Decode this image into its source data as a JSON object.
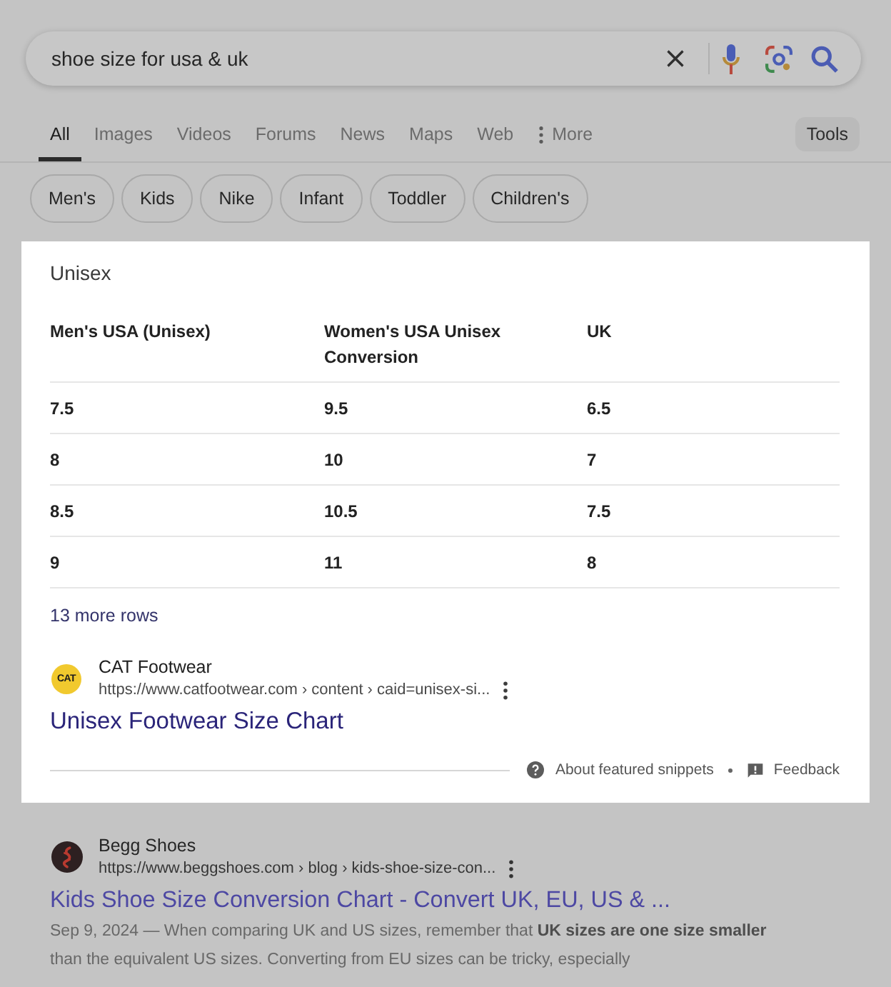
{
  "search": {
    "query": "shoe size for usa & uk"
  },
  "tabs": [
    {
      "label": "All",
      "selected": true,
      "kind": "tab"
    },
    {
      "label": "Images",
      "selected": false,
      "kind": "tab"
    },
    {
      "label": "Videos",
      "selected": false,
      "kind": "tab"
    },
    {
      "label": "Forums",
      "selected": false,
      "kind": "tab"
    },
    {
      "label": "News",
      "selected": false,
      "kind": "tab"
    },
    {
      "label": "Maps",
      "selected": false,
      "kind": "tab"
    },
    {
      "label": "Web",
      "selected": false,
      "kind": "tab"
    },
    {
      "label": "More",
      "selected": false,
      "kind": "menu"
    }
  ],
  "tools_button": "Tools",
  "chips": [
    "Men's",
    "Kids",
    "Nike",
    "Infant",
    "Toddler",
    "Children's"
  ],
  "featured_snippet": {
    "heading": "Unisex",
    "table": {
      "columns": [
        "Men's USA (Unisex)",
        "Women's USA Unisex Conversion",
        "UK"
      ],
      "rows": [
        [
          "7.5",
          "9.5",
          "6.5"
        ],
        [
          "8",
          "10",
          "7"
        ],
        [
          "8.5",
          "10.5",
          "7.5"
        ],
        [
          "9",
          "11",
          "8"
        ]
      ]
    },
    "more_rows": "13 more rows",
    "source": {
      "name": "CAT Footwear",
      "logo_text": "CAT",
      "url": "https://www.catfootwear.com › content › caid=unisex-si...",
      "title": "Unisex Footwear Size Chart"
    },
    "footer": {
      "about": "About featured snippets",
      "feedback": "Feedback"
    }
  },
  "results": [
    {
      "name": "Begg Shoes",
      "url": "https://www.beggshoes.com › blog › kids-shoe-size-con...",
      "title": "Kids Shoe Size Conversion Chart - Convert UK, EU, US & ...",
      "snippet": "Sep 9, 2024 — When comparing UK and US sizes, remember that **UK sizes are one size smaller** than the equivalent US sizes. Converting from EU sizes can be tricky, especially"
    }
  ]
}
